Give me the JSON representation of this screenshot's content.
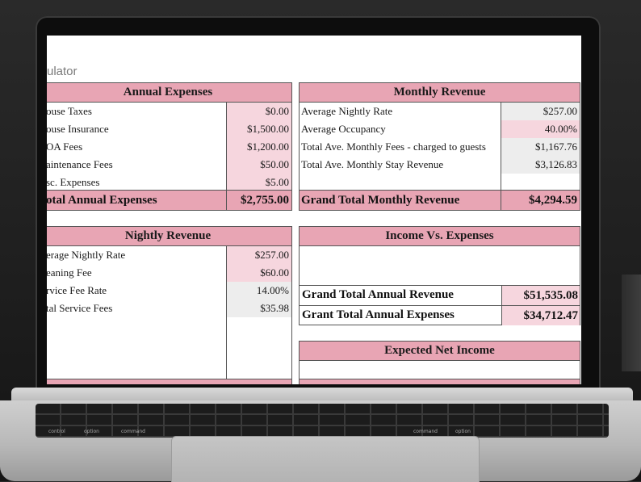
{
  "sheet": {
    "title_fragment": "ulator"
  },
  "annual_expenses": {
    "header": "Annual Expenses",
    "rows": [
      {
        "label": "ouse Taxes",
        "value": "$0.00"
      },
      {
        "label": "ouse Insurance",
        "value": "$1,500.00"
      },
      {
        "label": "OA Fees",
        "value": "$1,200.00"
      },
      {
        "label": "aintenance Fees",
        "value": "$50.00"
      },
      {
        "label": "sc. Expenses",
        "value": "$5.00"
      }
    ],
    "total_label": "otal Annual Expenses",
    "total_value": "$2,755.00"
  },
  "monthly_revenue": {
    "header": "Monthly Revenue",
    "rows": [
      {
        "label": "Average Nightly Rate",
        "value": "$257.00"
      },
      {
        "label": "Average Occupancy",
        "value": "40.00%"
      },
      {
        "label": "Total Ave. Monthly Fees - charged to guests",
        "value": "$1,167.76"
      },
      {
        "label": "Total Ave. Monthly Stay Revenue",
        "value": "$3,126.83"
      }
    ],
    "total_label": "Grand Total Monthly Revenue",
    "total_value": "$4,294.59"
  },
  "nightly_revenue": {
    "header": "Nightly Revenue",
    "rows": [
      {
        "label": "erage Nightly Rate",
        "value": "$257.00"
      },
      {
        "label": "eaning Fee",
        "value": "$60.00"
      },
      {
        "label": "rvice Fee Rate",
        "value": "14.00%"
      },
      {
        "label": "tal Service Fees",
        "value": "$35.98"
      }
    ]
  },
  "income_vs_expenses": {
    "header": "Income Vs. Expenses",
    "rows": [
      {
        "label": "Grand Total Annual Revenue",
        "value": "$51,535.08"
      },
      {
        "label": "Grant Total Annual Expenses",
        "value": "$34,712.47"
      }
    ]
  },
  "expected_net_income": {
    "header": "Expected Net Income"
  },
  "keyboard": {
    "labels": [
      "control",
      "option",
      "command",
      "command",
      "option"
    ]
  },
  "colors": {
    "header_pink": "#e8a5b4",
    "cell_pink": "#f6d6de",
    "cell_grey": "#ededed"
  }
}
